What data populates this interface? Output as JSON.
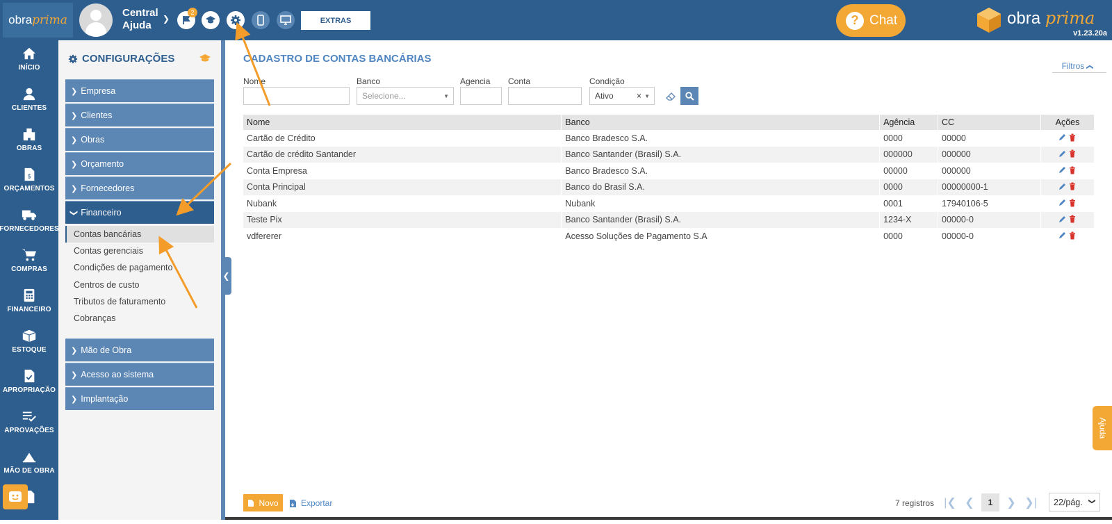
{
  "topbar": {
    "logo_word": "obra",
    "logo_script": "prima",
    "user_name": "Central Ajuda",
    "notifications_count": "2",
    "extras_label": "EXTRAS",
    "chat_label": "Chat",
    "brand_word": "obra",
    "brand_script": "prima",
    "version": "v1.23.20a"
  },
  "leftnav": [
    {
      "label": "INÍCIO",
      "icon": "home-icon"
    },
    {
      "label": "CLIENTES",
      "icon": "user-icon"
    },
    {
      "label": "OBRAS",
      "icon": "building-icon"
    },
    {
      "label": "ORÇAMENTOS",
      "icon": "dollar-doc-icon"
    },
    {
      "label": "FORNECEDORES",
      "icon": "truck-icon"
    },
    {
      "label": "COMPRAS",
      "icon": "cart-icon"
    },
    {
      "label": "FINANCEIRO",
      "icon": "calculator-icon"
    },
    {
      "label": "ESTOQUE",
      "icon": "box-icon"
    },
    {
      "label": "APROPRIAÇÃO",
      "icon": "doc-check-icon"
    },
    {
      "label": "APROVAÇÕES",
      "icon": "list-check-icon"
    },
    {
      "label": "MÃO DE OBRA",
      "icon": "workers-icon"
    }
  ],
  "config": {
    "title": "CONFIGURAÇÕES",
    "sections": [
      "Empresa",
      "Clientes",
      "Obras",
      "Orçamento",
      "Fornecedores",
      "Financeiro"
    ],
    "financeiro_items": [
      "Contas bancárias",
      "Contas gerenciais",
      "Condições de pagamento",
      "Centros de custo",
      "Tributos de faturamento",
      "Cobranças"
    ],
    "sections_after": [
      "Mão de Obra",
      "Acesso ao sistema",
      "Implantação"
    ]
  },
  "main": {
    "title": "CADASTRO DE CONTAS BANCÁRIAS",
    "filtros_label": "Filtros",
    "filters": {
      "nome_label": "Nome",
      "banco_label": "Banco",
      "banco_placeholder": "Selecione...",
      "agencia_label": "Agencia",
      "conta_label": "Conta",
      "condicao_label": "Condição",
      "condicao_value": "Ativo"
    },
    "table": {
      "headers": [
        "Nome",
        "Banco",
        "Agência",
        "CC",
        "Ações"
      ],
      "rows": [
        [
          "Cartão de Crédito",
          "Banco Bradesco S.A.",
          "0000",
          "00000"
        ],
        [
          "Cartão de crédito Santander",
          "Banco Santander (Brasil) S.A.",
          "000000",
          "000000"
        ],
        [
          "Conta Empresa",
          "Banco Bradesco S.A.",
          "00000",
          "000000"
        ],
        [
          "Conta Principal",
          "Banco do Brasil S.A.",
          "0000",
          "00000000-1"
        ],
        [
          "Nubank",
          "Nubank",
          "0001",
          "17940106-5"
        ],
        [
          "Teste Pix",
          "Banco Santander (Brasil) S.A.",
          "1234-X",
          "00000-0"
        ],
        [
          "vdfererer",
          "Acesso Soluções de Pagamento S.A",
          "0000",
          "00000-0"
        ]
      ]
    },
    "footer": {
      "novo_label": "Novo",
      "exportar_label": "Exportar",
      "registros": "7 registros",
      "current_page": "1",
      "per_page": "22/pág."
    },
    "ajuda_tab": "Ajuda"
  },
  "colors": {
    "topbar": "#2e5e8e",
    "accent": "#f3a735",
    "section": "#5c87b5",
    "title": "#4f86c1"
  }
}
